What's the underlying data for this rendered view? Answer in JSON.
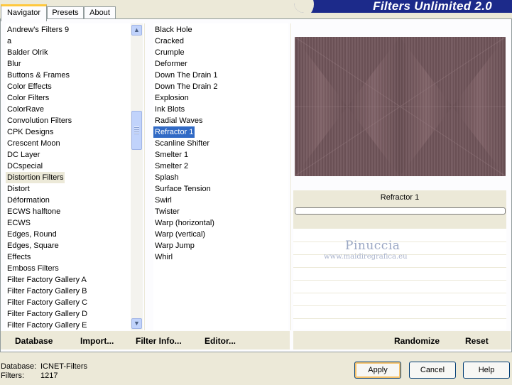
{
  "banner_title": "Filters Unlimited 2.0",
  "tabs": [
    "Navigator",
    "Presets",
    "About"
  ],
  "categories": [
    "Andrew's Filters 9",
    "a",
    "Balder Olrik",
    "Blur",
    "Buttons & Frames",
    "Color Effects",
    "Color Filters",
    "ColorRave",
    "Convolution Filters",
    "CPK Designs",
    "Crescent Moon",
    "DC Layer",
    "DCspecial",
    "Distortion Filters",
    "Distort",
    "Déformation",
    "ECWS halftone",
    "ECWS",
    "Edges, Round",
    "Edges, Square",
    "Effects",
    "Emboss Filters",
    "Filter Factory Gallery A",
    "Filter Factory Gallery B",
    "Filter Factory Gallery C",
    "Filter Factory Gallery D",
    "Filter Factory Gallery E"
  ],
  "selected_category": "Distortion Filters",
  "filters": [
    "Black Hole",
    "Cracked",
    "Crumple",
    "Deformer",
    "Down The Drain 1",
    "Down The Drain 2",
    "Explosion",
    "Ink Blots",
    "Radial Waves",
    "Refractor 1",
    "Scanline Shifter",
    "Smelter 1",
    "Smelter 2",
    "Splash",
    "Surface Tension",
    "Swirl",
    "Twister",
    "Warp (horizontal)",
    "Warp (vertical)",
    "Warp Jump",
    "Whirl"
  ],
  "selected_filter": "Refractor 1",
  "current_filter_name": "Refractor 1",
  "progress": 0,
  "commands": {
    "database": "Database",
    "import": "Import...",
    "filter_info": "Filter Info...",
    "editor": "Editor..."
  },
  "right_commands": {
    "randomize": "Randomize",
    "reset": "Reset"
  },
  "watermark": {
    "name": "Pinuccia",
    "site": "www.maidiregrafica.eu"
  },
  "status": {
    "database_label": "Database:",
    "database_value": "ICNET-Filters",
    "filters_label": "Filters:",
    "filters_value": "1217"
  },
  "buttons": {
    "apply": "Apply",
    "cancel": "Cancel",
    "help": "Help"
  },
  "colors": {
    "banner": "#1c2a8a",
    "selection": "#316ac5",
    "preview": "#6e5458",
    "tab_highlight": "#ffc83c"
  },
  "icons": {
    "scroll_up": "chevron-up-icon",
    "scroll_down": "chevron-down-icon"
  }
}
